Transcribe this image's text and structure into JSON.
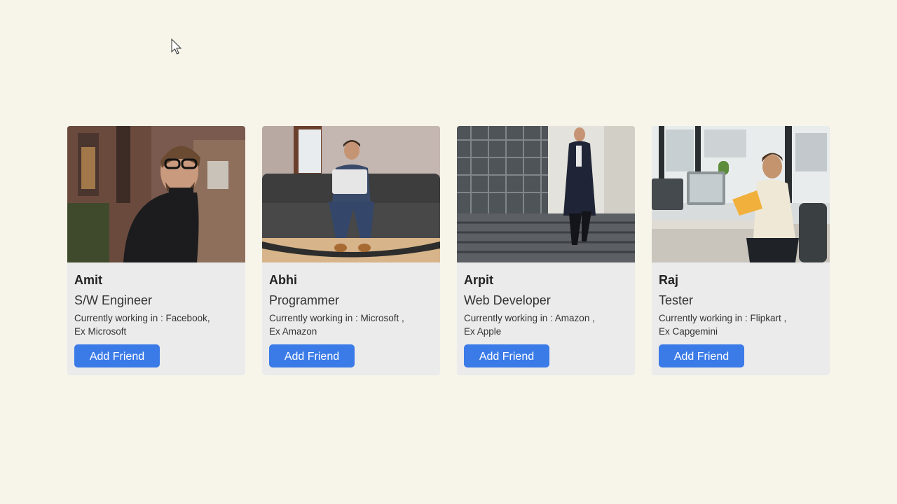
{
  "profiles": [
    {
      "name": "Amit",
      "role": "S/W Engineer",
      "work_line1": "Currently working in : Facebook,",
      "work_line2": "Ex Microsoft",
      "button_label": "Add Friend"
    },
    {
      "name": "Abhi",
      "role": "Programmer",
      "work_line1": "Currently working in : Microsoft ,",
      "work_line2": "Ex Amazon",
      "button_label": "Add Friend"
    },
    {
      "name": "Arpit",
      "role": "Web Developer",
      "work_line1": "Currently working in : Amazon ,",
      "work_line2": "Ex Apple",
      "button_label": "Add Friend"
    },
    {
      "name": "Raj",
      "role": "Tester",
      "work_line1": "Currently working in : Flipkart ,",
      "work_line2": "Ex Capgemini",
      "button_label": "Add Friend"
    }
  ],
  "colors": {
    "background": "#f7f4ea",
    "card": "#ebebeb",
    "button": "#3b7be8",
    "button_text": "#ffffff"
  },
  "icons": {
    "cursor": "mouse-pointer-icon"
  }
}
